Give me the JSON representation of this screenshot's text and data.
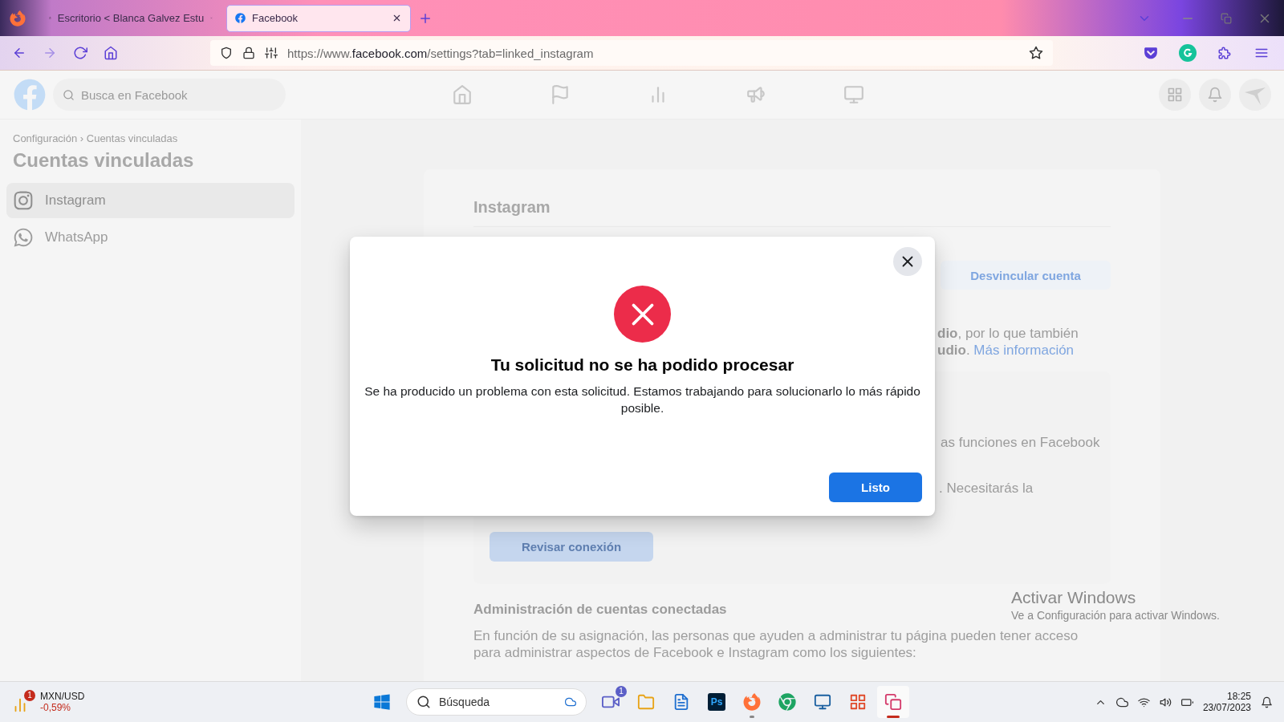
{
  "browser": {
    "tabs": [
      {
        "title": "Escritorio < Blanca Galvez Estu",
        "selected": false
      },
      {
        "title": "Facebook",
        "selected": true
      }
    ],
    "url": "https://www.**facebook.com**/settings?tab=linked_instagram"
  },
  "facebook": {
    "search": {
      "placeholder": "Busca en Facebook"
    }
  },
  "sidebar": {
    "breadcrumb": "Configuración › Cuentas vinculadas",
    "title": "Cuentas vinculadas",
    "items": [
      {
        "label": "Instagram",
        "kind": "instagram",
        "selected": true
      },
      {
        "label": "WhatsApp",
        "kind": "whatsapp",
        "selected": false
      }
    ]
  },
  "card": {
    "title": "Instagram",
    "unlink_button": "Desvincular cuenta",
    "note_lines": [
      {
        "text": "**dio**, por lo que también"
      },
      {
        "text": "**udio**.",
        "link": "Más información"
      }
    ],
    "panel": {
      "lines": [
        "as funciones en Facebook",
        ". Necesitarás la"
      ],
      "button": "Revisar conexión"
    },
    "management": {
      "title": "Administración de cuentas conectadas",
      "text": "En función de su asignación, las personas que ayuden a administrar tu página pueden tener acceso para administrar aspectos de Facebook e Instagram como los siguientes:"
    }
  },
  "dialog": {
    "title": "Tu solicitud no se ha podido procesar",
    "message": "Se ha producido un problema con esta solicitud. Estamos trabajando para solucionarlo lo más rápido posible.",
    "button": "Listo"
  },
  "windows_activation": {
    "title": "Activar Windows",
    "subtitle": "Ve a Configuración para activar Windows."
  },
  "taskbar": {
    "widget": {
      "badge": "1",
      "title": "MXN/USD",
      "change": "-0,59%"
    },
    "search": {
      "placeholder": "Búsqueda"
    },
    "apps": [
      {
        "kind": "start",
        "open": false,
        "focused": false
      },
      {
        "kind": "teams",
        "badge": "1",
        "open": false,
        "focused": false
      },
      {
        "kind": "folder",
        "open": false,
        "focused": false
      },
      {
        "kind": "notepad",
        "open": false,
        "focused": false
      },
      {
        "kind": "photoshop",
        "label": "Ps",
        "open": false,
        "focused": false
      },
      {
        "kind": "firefox",
        "open": true,
        "focused": false
      },
      {
        "kind": "chrome",
        "open": false,
        "focused": false
      },
      {
        "kind": "cocktail",
        "open": false,
        "focused": false
      },
      {
        "kind": "game",
        "open": false,
        "focused": false
      },
      {
        "kind": "snip",
        "open": true,
        "focused": true
      }
    ],
    "time": "18:25",
    "date": "23/07/2023"
  }
}
